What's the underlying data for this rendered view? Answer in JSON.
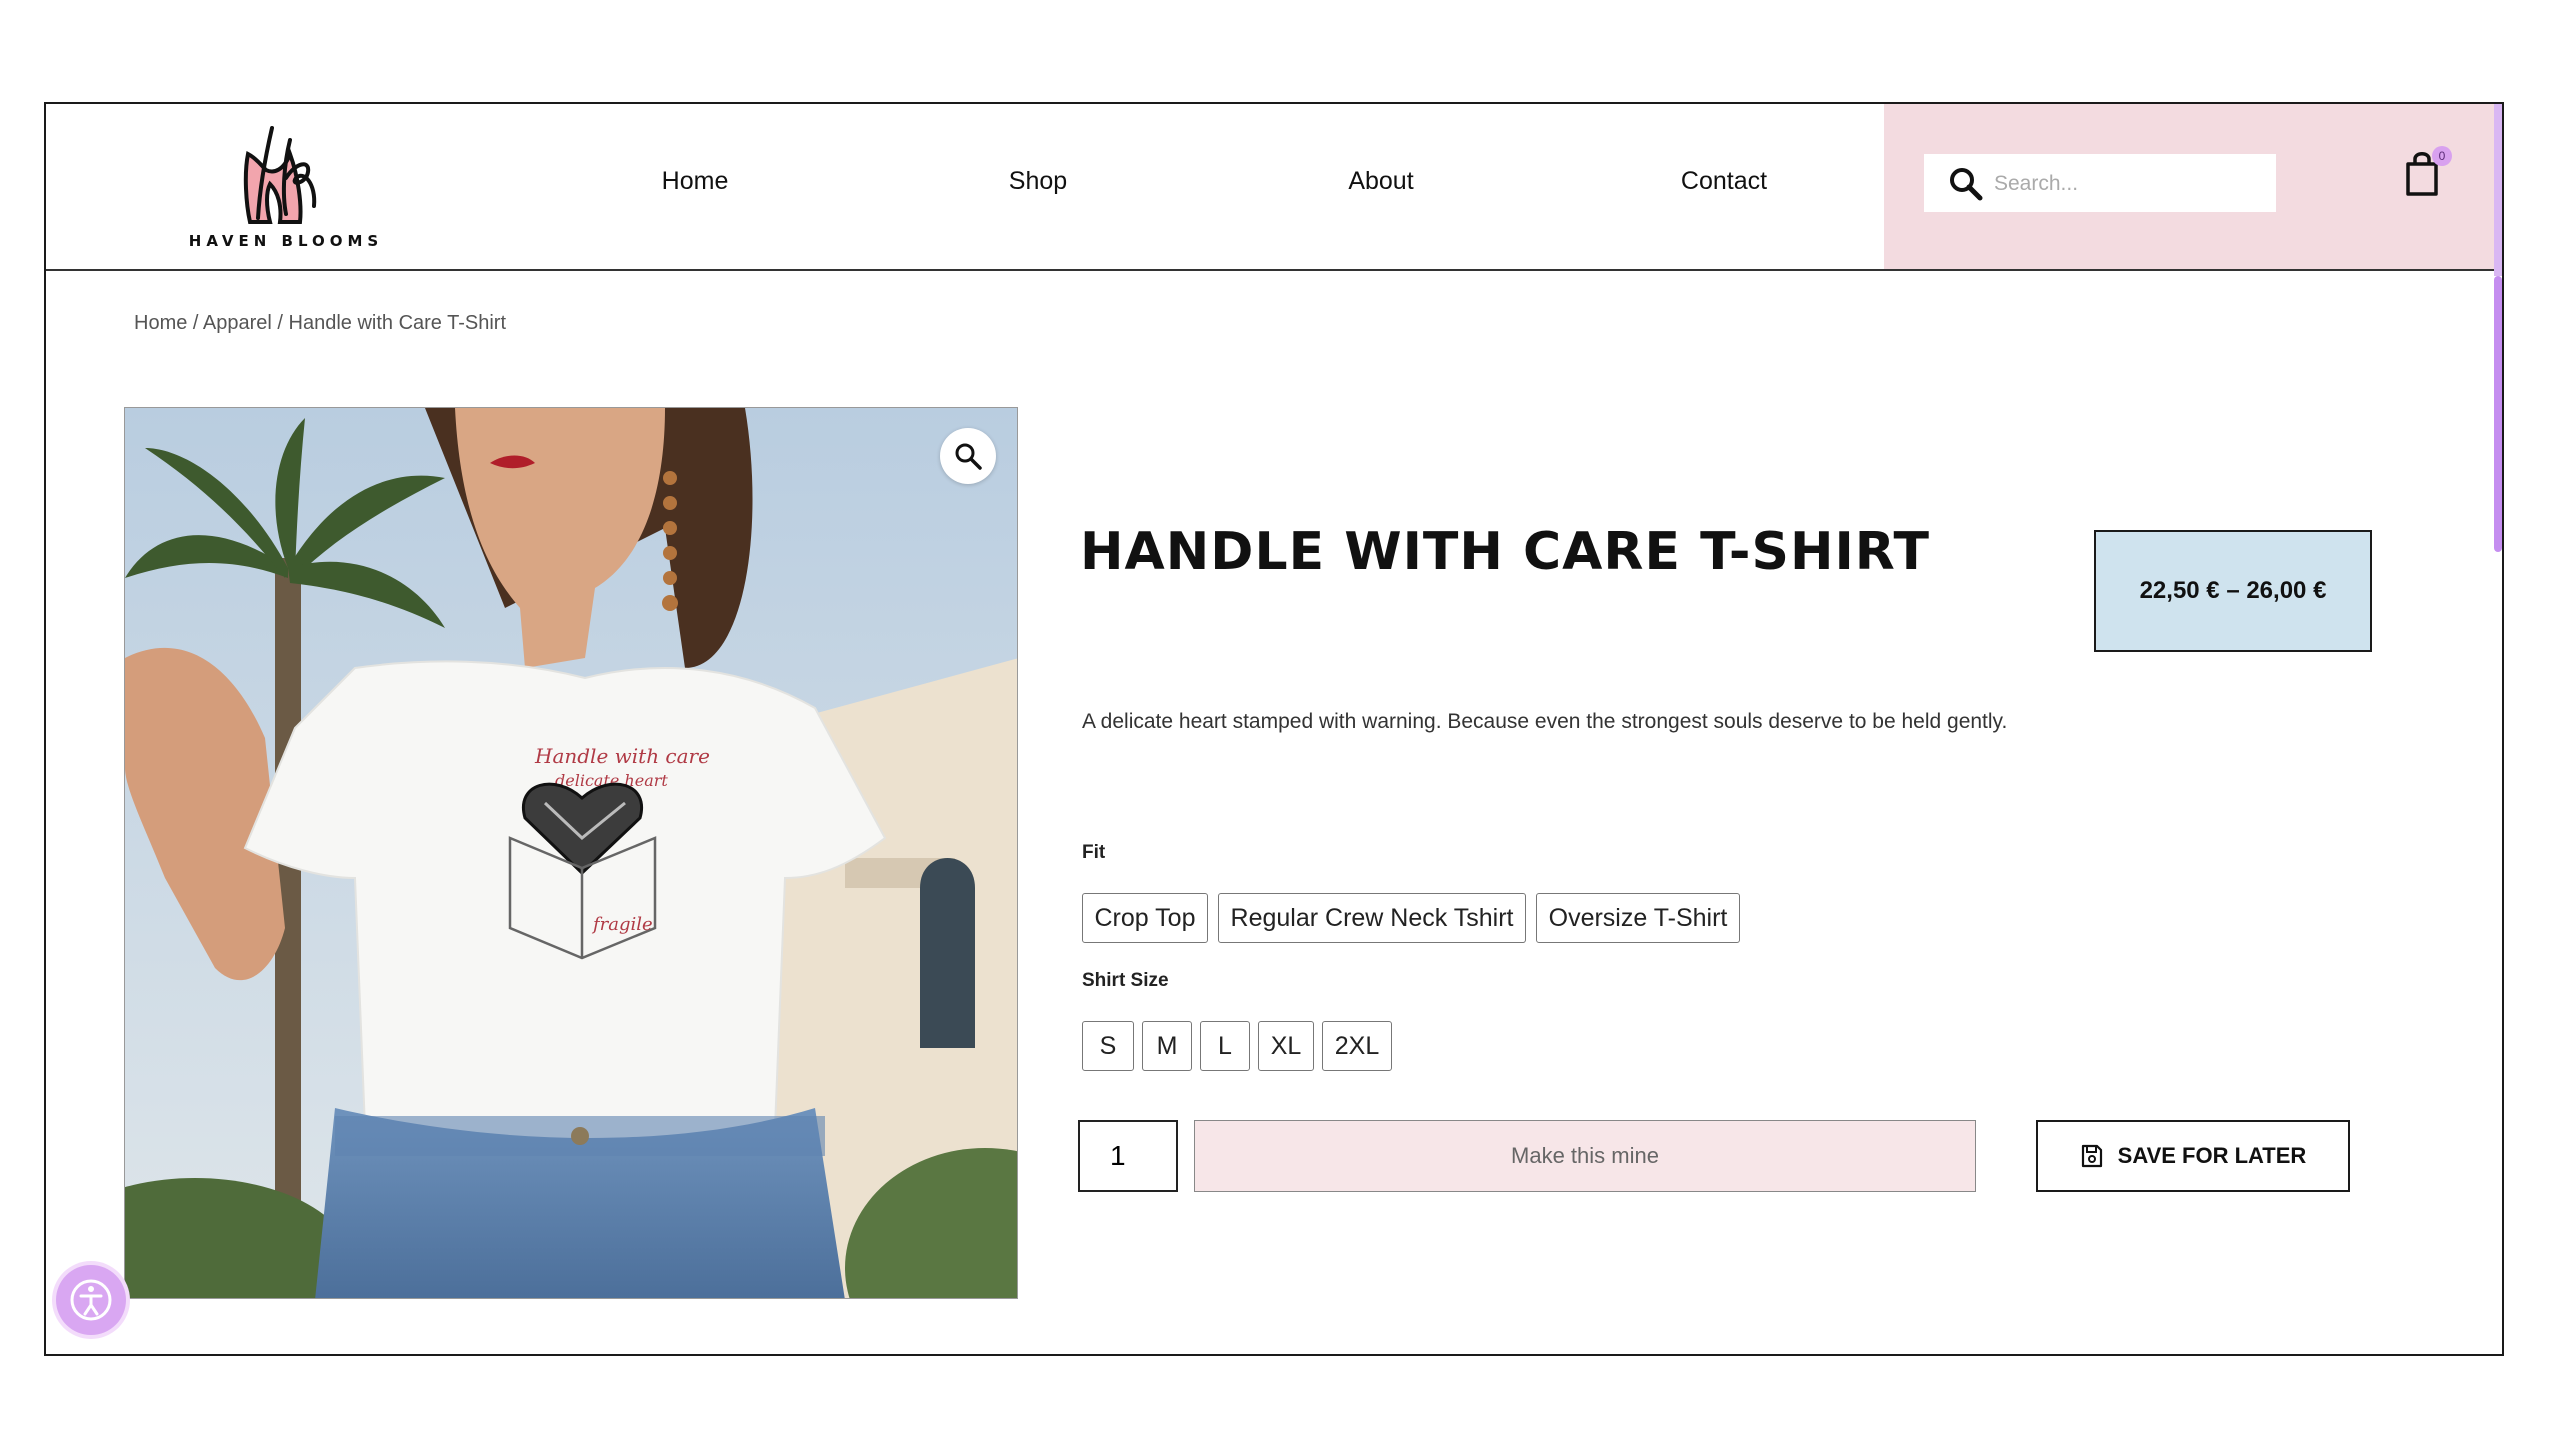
{
  "brand": {
    "name": "HAVEN BLOOMS"
  },
  "nav": {
    "items": [
      "Home",
      "Shop",
      "About",
      "Contact"
    ]
  },
  "search": {
    "placeholder": "Search..."
  },
  "cart": {
    "count": "0"
  },
  "breadcrumb": "Home / Apparel / Handle with Care T-Shirt",
  "product": {
    "title": "HANDLE WITH CARE T-SHIRT",
    "price": "22,50 € – 26,00 €",
    "description": "A delicate heart stamped with warning. Because even the strongest souls deserve to be held gently.",
    "fit": {
      "label": "Fit",
      "options": [
        "Crop Top",
        "Regular Crew Neck Tshirt",
        "Oversize T-Shirt"
      ]
    },
    "size": {
      "label": "Shirt Size",
      "options": [
        "S",
        "M",
        "L",
        "XL",
        "2XL"
      ]
    },
    "quantity": "1",
    "add_to_cart_label": "Make this mine",
    "save_label": "SAVE FOR LATER",
    "shirt_print": {
      "line1": "Handle with care",
      "line2": "delicate heart",
      "box_text": "fragile"
    }
  },
  "colors": {
    "header_accent": "#f3dbe0",
    "price_box": "#cfe3ee",
    "add_button": "#f7e6e8",
    "scroll_accent": "#c58ef0"
  },
  "icons": [
    "search-icon",
    "cart-icon",
    "zoom-icon",
    "save-icon",
    "accessibility-icon"
  ]
}
